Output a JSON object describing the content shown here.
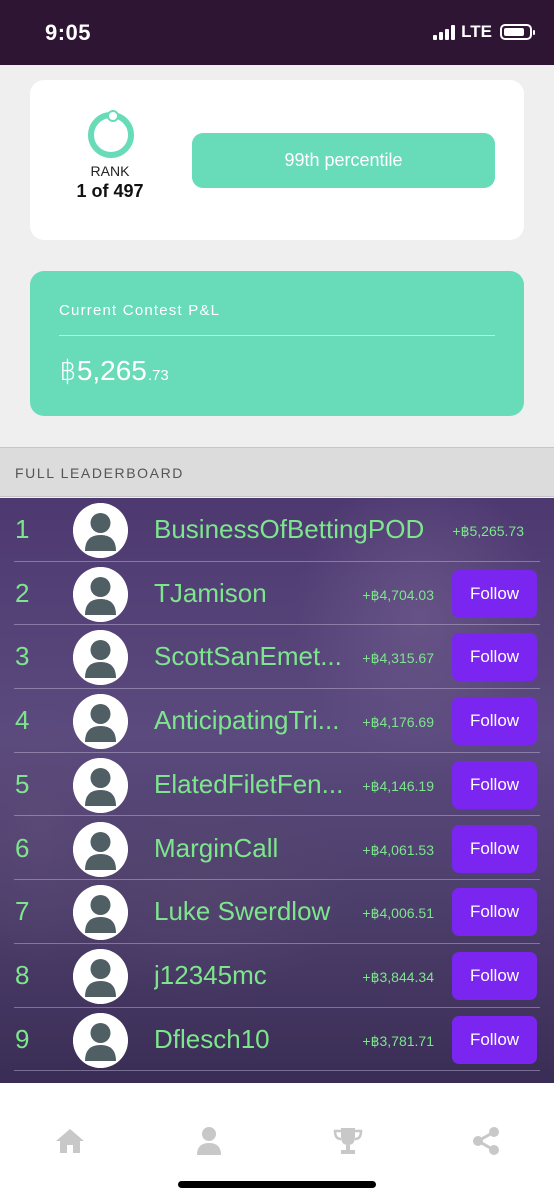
{
  "status_bar": {
    "time": "9:05",
    "network": "LTE"
  },
  "rank": {
    "label": "RANK",
    "value": "1 of 497"
  },
  "percentile": {
    "label": "99th percentile"
  },
  "pnl": {
    "label": "Current Contest P&L",
    "main": "฿5,265",
    "cents": ".73"
  },
  "leaderboard": {
    "header": "FULL LEADERBOARD",
    "follow_label": "Follow",
    "rows": [
      {
        "rank": "1",
        "name": "BusinessOfBettingPOD",
        "pnl": "+฿5,265.73"
      },
      {
        "rank": "2",
        "name": "TJamison",
        "pnl": "+฿4,704.03"
      },
      {
        "rank": "3",
        "name": "ScottSanEmet...",
        "pnl": "+฿4,315.67"
      },
      {
        "rank": "4",
        "name": "AnticipatingTri...",
        "pnl": "+฿4,176.69"
      },
      {
        "rank": "5",
        "name": "ElatedFiletFen...",
        "pnl": "+฿4,146.19"
      },
      {
        "rank": "6",
        "name": "MarginCall",
        "pnl": "+฿4,061.53"
      },
      {
        "rank": "7",
        "name": "Luke Swerdlow",
        "pnl": "+฿4,006.51"
      },
      {
        "rank": "8",
        "name": "j12345mc",
        "pnl": "+฿3,844.34"
      },
      {
        "rank": "9",
        "name": "Dflesch10",
        "pnl": "+฿3,781.71"
      }
    ]
  },
  "bottom_nav": {
    "icons": [
      "home-icon",
      "profile-icon",
      "trophy-icon",
      "share-icon"
    ]
  },
  "colors": {
    "accent": "#68dbb9",
    "follow": "#7b25f0",
    "status_bar": "#2e1533",
    "leader_text": "#7de68c"
  }
}
